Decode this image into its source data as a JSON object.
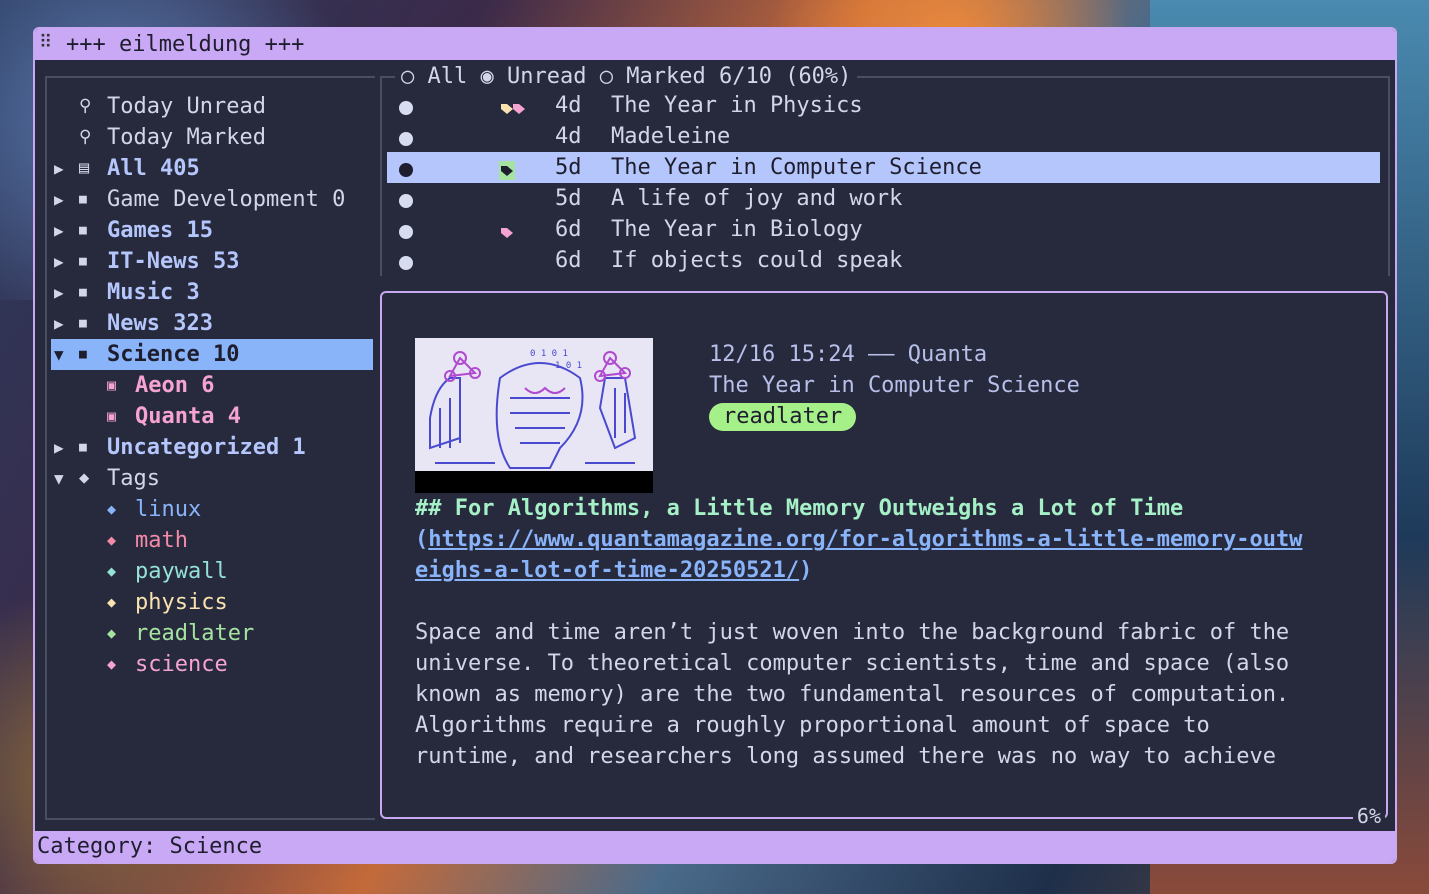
{
  "window": {
    "title": "+++ eilmeldung +++"
  },
  "sidebar": {
    "items": [
      {
        "icon": "search-icon",
        "label": "Today Unread",
        "bold": false,
        "indent": 0,
        "arrow": ""
      },
      {
        "icon": "search-icon",
        "label": "Today Marked",
        "bold": false,
        "indent": 0,
        "arrow": ""
      },
      {
        "icon": "newspaper-icon",
        "label": "All 405",
        "bold": true,
        "indent": 0,
        "arrow": "▶"
      },
      {
        "icon": "folder-icon",
        "label": "Game Development 0",
        "bold": false,
        "indent": 0,
        "arrow": "▶"
      },
      {
        "icon": "folder-icon",
        "label": "Games 15",
        "bold": true,
        "indent": 0,
        "arrow": "▶"
      },
      {
        "icon": "folder-icon",
        "label": "IT-News 53",
        "bold": true,
        "indent": 0,
        "arrow": "▶"
      },
      {
        "icon": "folder-icon",
        "label": "Music 3",
        "bold": true,
        "indent": 0,
        "arrow": "▶"
      },
      {
        "icon": "folder-icon",
        "label": "News 323",
        "bold": true,
        "indent": 0,
        "arrow": "▶"
      },
      {
        "icon": "folder-open-icon",
        "label": "Science 10",
        "bold": true,
        "indent": 0,
        "arrow": "▼",
        "selected": true
      },
      {
        "icon": "rss-icon",
        "label": "Aeon 6",
        "bold": true,
        "indent": 1,
        "arrow": ""
      },
      {
        "icon": "rss-icon",
        "label": "Quanta 4",
        "bold": true,
        "indent": 1,
        "arrow": ""
      },
      {
        "icon": "folder-icon",
        "label": "Uncategorized 1",
        "bold": true,
        "indent": 0,
        "arrow": "▶"
      },
      {
        "icon": "tags-icon",
        "label": "Tags",
        "bold": false,
        "indent": 0,
        "arrow": "▼"
      }
    ],
    "tags": [
      {
        "label": "linux",
        "color": "#89b4fa"
      },
      {
        "label": "math",
        "color": "#f38ba8"
      },
      {
        "label": "paywall",
        "color": "#94e2d5"
      },
      {
        "label": "physics",
        "color": "#f9e2af"
      },
      {
        "label": "readlater",
        "color": "#a6e3a1"
      },
      {
        "label": "science",
        "color": "#f5a3d0"
      }
    ]
  },
  "filter": {
    "all_label": "All",
    "unread_label": "Unread",
    "marked_label": "Marked",
    "progress": "6/10 (60%)"
  },
  "articles": [
    {
      "age": "4d",
      "title": "The Year in Physics",
      "tags": [
        "#f9e2af",
        "#f5a3d0"
      ]
    },
    {
      "age": "4d",
      "title": "Madeleine",
      "tags": []
    },
    {
      "age": "5d",
      "title": "The Year in Computer Science",
      "tags": [
        "#a6e3a1"
      ],
      "selected": true
    },
    {
      "age": "5d",
      "title": "A life of joy and work",
      "tags": []
    },
    {
      "age": "6d",
      "title": "The Year in Biology",
      "tags": [
        "#f5a3d0"
      ]
    },
    {
      "age": "6d",
      "title": "If objects could speak",
      "tags": []
    }
  ],
  "reader": {
    "datetime": "12/16 15:24",
    "separator": "——",
    "source": "Quanta",
    "title": "The Year in Computer Science",
    "tag": "readlater",
    "heading": "## For Algorithms, a Little Memory Outweighs a Lot of Time",
    "link_open": "(",
    "link_line1": "https://www.quantamagazine.org/for-algorithms-a-little-memory-outw",
    "link_line2": "eighs-a-lot-of-time-20250521/",
    "link_close": ")",
    "paragraph": [
      "Space and time aren’t just woven into the background fabric of the",
      "universe. To theoretical computer scientists, time and space (also",
      "known as memory) are the two fundamental resources of computation.",
      "Algorithms require a roughly proportional amount of space to",
      "runtime, and researchers long assumed there was no way to achieve"
    ],
    "scroll_percent": "6%"
  },
  "status": {
    "text": "Category: Science"
  },
  "colors": {
    "accent": "#c9a8f5",
    "selection": "#89b4fa",
    "badge": "#a6f08a"
  }
}
